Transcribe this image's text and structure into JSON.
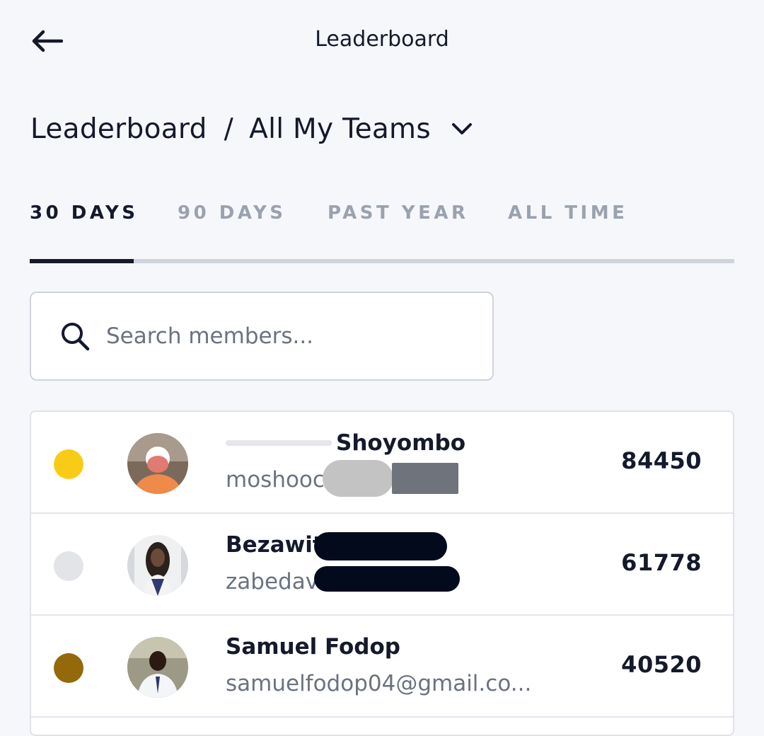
{
  "header": {
    "title": "Leaderboard",
    "back_icon": "arrow-left-icon"
  },
  "breadcrumb": {
    "root": "Leaderboard",
    "separator": "/",
    "team": "All My Teams",
    "dropdown_icon": "chevron-down-icon"
  },
  "tabs": [
    {
      "label": "30 DAYS",
      "active": true
    },
    {
      "label": "90 DAYS",
      "active": false
    },
    {
      "label": "PAST YEAR",
      "active": false
    },
    {
      "label": "ALL TIME",
      "active": false
    }
  ],
  "search": {
    "placeholder": "Search members...",
    "value": "",
    "icon": "search-icon"
  },
  "members": [
    {
      "rank": 1,
      "medal_color": "#f8cc16",
      "name": "Shoyombo",
      "email": "moshooc",
      "score": "84450"
    },
    {
      "rank": 2,
      "medal_color": "#e2e4e8",
      "name": "Bezawit",
      "email": "zabedav",
      "score": "61778"
    },
    {
      "rank": 3,
      "medal_color": "#94690a",
      "name": "Samuel Fodop",
      "email": "samuelfodop04@gmail.co...",
      "score": "40520"
    }
  ],
  "colors": {
    "background": "#f6f7fb",
    "text": "#14192b",
    "muted": "#9aa2ad",
    "border": "#cfd4dc"
  }
}
